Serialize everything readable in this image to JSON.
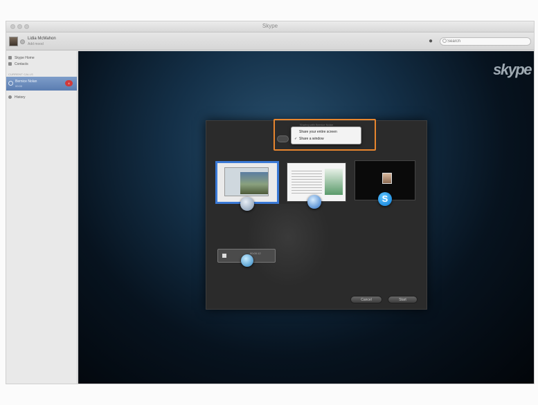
{
  "window": {
    "title": "Skype"
  },
  "user": {
    "name": "Lidia McMahon",
    "mood": "Add mood"
  },
  "search": {
    "placeholder": "Search"
  },
  "sidebar": {
    "items": [
      {
        "label": "Skype Home",
        "icon": "home-icon"
      },
      {
        "label": "Contacts",
        "icon": "contacts-icon"
      }
    ],
    "section_label": "CURRENT CALLS",
    "active_call": {
      "name": "Bernice Nolan",
      "time": "00:00",
      "badge": "4"
    },
    "history_label": "History"
  },
  "stage": {
    "logo": "skype"
  },
  "share_dialog": {
    "title": "Sharing with Bernice Nolan",
    "menu": [
      {
        "label": "Share your entire screen",
        "checked": false
      },
      {
        "label": "Share a window",
        "checked": true
      }
    ],
    "check_glyph": "✓",
    "small_window_text": "00:00:12",
    "cancel_label": "Cancel",
    "start_label": "Start",
    "skype_letter": "S"
  },
  "colors": {
    "highlight": "#e8862e",
    "selected_thumb": "#3a79d6",
    "call_item": "#6a8cc0"
  }
}
